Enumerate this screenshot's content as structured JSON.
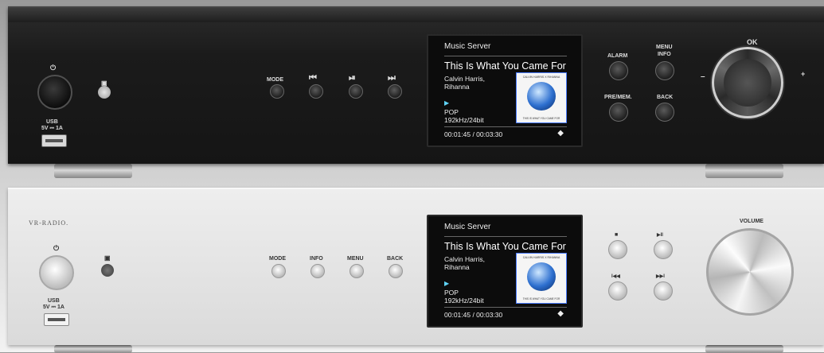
{
  "units": {
    "black": {
      "power_icon": "⏻",
      "usb_label": "USB",
      "usb_spec": "5V ⎓ 1A",
      "buttons": {
        "mode": "MODE",
        "prev_icon": "⏮",
        "playpause_icon": "⏯",
        "next_icon": "⏭",
        "alarm": "ALARM",
        "menu_info": "MENU\nINFO",
        "pre_mem": "PRE/MEM.",
        "back": "BACK"
      },
      "knob": {
        "ok": "OK",
        "minus": "–",
        "plus": "+"
      }
    },
    "silver": {
      "brand": "VR-RADIO.",
      "power_icon": "⏻",
      "usb_label": "USB",
      "usb_spec": "5V ⎓ 1A",
      "buttons": {
        "mode": "MODE",
        "info": "INFO",
        "menu": "MENU",
        "back": "BACK",
        "stop_icon": "■",
        "playpause_icon": "▶II",
        "prev_icon": "I◀◀",
        "next_icon": "▶▶I"
      },
      "knob": {
        "volume": "VOLUME"
      }
    }
  },
  "screen": {
    "source": "Music Server",
    "song_title": "This Is What You Came For",
    "artist": "Calvin Harris, Rihanna",
    "genre": "POP",
    "quality": "192kHz/24bit",
    "time": "00:01:45 / 00:03:30",
    "album_art_top": "CALVIN HARRIS X RIHANNA",
    "album_art_bottom": "THIS IS WHAT YOU CAME FOR",
    "play_icon": "▶",
    "wifi_icon": "◆"
  }
}
